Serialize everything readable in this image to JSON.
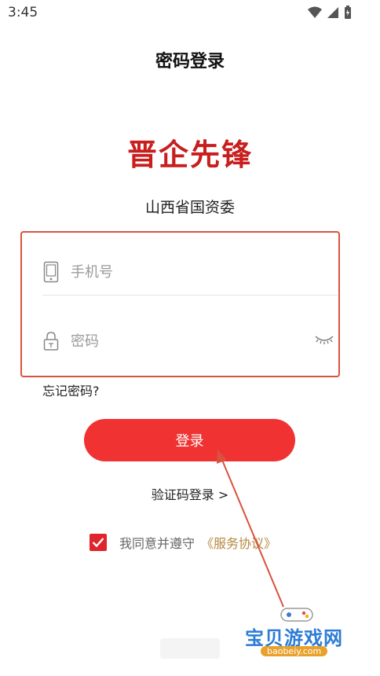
{
  "status_bar": {
    "time": "3:45"
  },
  "header": {
    "title": "密码登录"
  },
  "brand": {
    "logo_text": "晋企先锋",
    "org_name": "山西省国资委",
    "logo_color": "#c81e1e"
  },
  "form": {
    "phone": {
      "placeholder": "手机号",
      "icon": "phone-icon"
    },
    "password": {
      "placeholder": "密码",
      "icon": "lock-icon",
      "toggle_icon": "eye-closed-icon"
    },
    "forgot_label": "忘记密码?"
  },
  "actions": {
    "login_label": "登录",
    "sms_login_label": "验证码登录 >"
  },
  "agreement": {
    "checked": true,
    "text": "我同意并遵守",
    "link_text": "《服务协议》"
  },
  "watermark": {
    "title": "宝贝游戏网",
    "url": "baobeiy.com"
  },
  "colors": {
    "accent": "#f03232",
    "highlight_box": "#d8523f",
    "link": "#b6883f"
  }
}
